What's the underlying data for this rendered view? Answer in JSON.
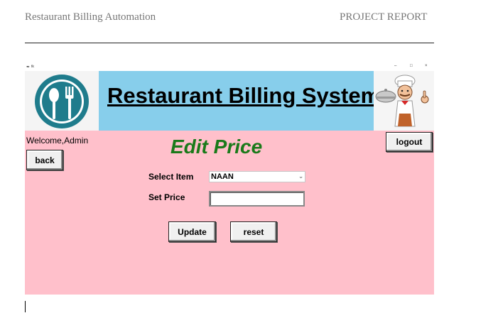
{
  "document": {
    "header_left": "Restaurant Billing Automation",
    "header_right": "PROJECT REPORT"
  },
  "window": {
    "title": "tk",
    "controls": {
      "minimize": "–",
      "maximize": "□",
      "close": "×"
    }
  },
  "banner": {
    "title": "Restaurant Billing System",
    "logo_icon": "spoon-fork-icon",
    "chef_icon": "chef-icon",
    "colors": {
      "banner_bg": "#87ceeb",
      "logo_circle": "#1f7c8c"
    }
  },
  "main": {
    "welcome_text": "Welcome,Admin",
    "back_label": "back",
    "logout_label": "logout",
    "heading": "Edit Price",
    "select_item_label": "Select Item",
    "select_item_value": "NAAN",
    "set_price_label": "Set Price",
    "set_price_value": "",
    "update_label": "Update",
    "reset_label": "reset",
    "colors": {
      "background": "#ffc0cb",
      "heading": "#1a7a1a"
    }
  }
}
